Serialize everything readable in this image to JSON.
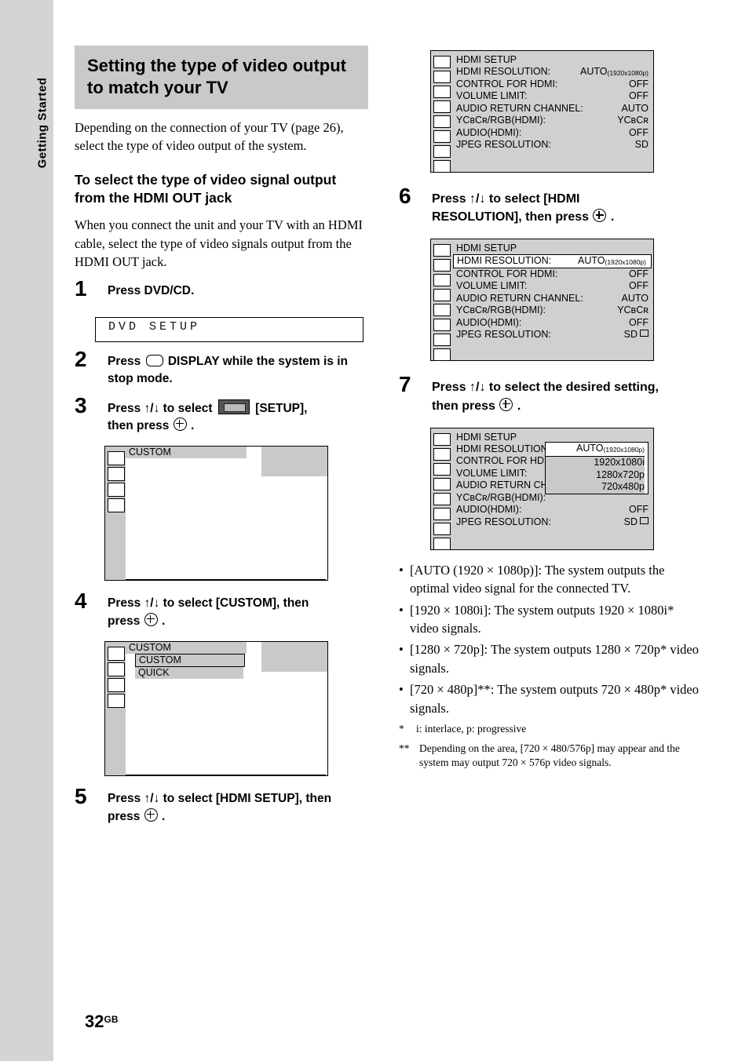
{
  "sidebar": {
    "label": "Getting Started"
  },
  "page": {
    "number": "32",
    "suffix": "GB"
  },
  "left": {
    "title": "Setting the type of video output to match your TV",
    "intro": "Depending on the connection of your TV (page 26), select the type of video output of the system.",
    "subhead": "To select the type of video signal output from the HDMI OUT jack",
    "para2": "When you connect the unit and your TV with an HDMI cable, select the type of video signals output from the HDMI OUT jack.",
    "steps": [
      {
        "num": "1",
        "text": "Press DVD/CD."
      },
      {
        "num": "2",
        "text_pre": "Press",
        "text_post": "DISPLAY while the system is in stop mode."
      },
      {
        "num": "3",
        "text_pre": "Press ↑/↓ to select",
        "text_mid": "[SETUP],",
        "text_post": "then press"
      },
      {
        "num": "4",
        "text_pre": "Press ↑/↓ to select [CUSTOM], then",
        "text_post": "press"
      },
      {
        "num": "5",
        "text_pre": "Press ↑/↓ to select [HDMI SETUP], then",
        "text_post": "press"
      }
    ],
    "fl_display": "DVD  SETUP",
    "osd1": {
      "row1": "CUSTOM"
    },
    "osd2": {
      "row1": "CUSTOM",
      "row2": "CUSTOM",
      "row3": "QUICK"
    }
  },
  "right": {
    "steps": [
      {
        "num": "6",
        "text_pre": "Press ↑/↓ to select [HDMI",
        "text_mid": "RESOLUTION], then press",
        "text_post": "."
      },
      {
        "num": "7",
        "text_pre": "Press ↑/↓ to select the desired setting,",
        "text_post": "then press"
      }
    ],
    "screen1": {
      "title": "HDMI SETUP",
      "rows": [
        {
          "label": "HDMI RESOLUTION:",
          "value": "AUTO",
          "value_sub": "(1920x1080p)"
        },
        {
          "label": "CONTROL FOR HDMI:",
          "value": "OFF"
        },
        {
          "label": "VOLUME LIMIT:",
          "value": "OFF"
        },
        {
          "label": "AUDIO RETURN CHANNEL:",
          "value": "AUTO"
        },
        {
          "label": "YCʙCʀ/RGB(HDMI):",
          "value": "YCʙCʀ"
        },
        {
          "label": "AUDIO(HDMI):",
          "value": "OFF"
        },
        {
          "label": "JPEG RESOLUTION:",
          "value": "SD"
        }
      ]
    },
    "screen2": {
      "title": "HDMI SETUP",
      "rows": [
        {
          "label": "HDMI RESOLUTION:",
          "value": "AUTO",
          "value_sub": "(1920x1080p)",
          "selected": true
        },
        {
          "label": "CONTROL FOR HDMI:",
          "value": "OFF"
        },
        {
          "label": "VOLUME LIMIT:",
          "value": "OFF"
        },
        {
          "label": "AUDIO RETURN CHANNEL:",
          "value": "AUTO"
        },
        {
          "label": "YCʙCʀ/RGB(HDMI):",
          "value": "YCʙCʀ"
        },
        {
          "label": "AUDIO(HDMI):",
          "value": "OFF"
        },
        {
          "label": "JPEG RESOLUTION:",
          "value": "SD"
        }
      ]
    },
    "screen3": {
      "title": "HDMI SETUP",
      "rows": [
        {
          "label": "HDMI RESOLUTION:",
          "value": "AUTO",
          "value_sub": "(1920x1080p)"
        },
        {
          "label": "CONTROL FOR HDM",
          "value": ""
        },
        {
          "label": "VOLUME LIMIT:",
          "value": ""
        },
        {
          "label": "AUDIO RETURN CH",
          "value": ""
        },
        {
          "label": "YCʙCʀ/RGB(HDMI):",
          "value": ""
        },
        {
          "label": "AUDIO(HDMI):",
          "value": "OFF"
        },
        {
          "label": "JPEG RESOLUTION:",
          "value": "SD"
        }
      ],
      "popup": [
        {
          "value": "AUTO",
          "value_sub": "(1920x1080p)",
          "selected": true
        },
        {
          "value": "1920x1080i"
        },
        {
          "value": "1280x720p"
        },
        {
          "value": "720x480p"
        }
      ]
    },
    "bullets": [
      "[AUTO (1920 × 1080p)]: The system outputs the optimal video signal for the connected TV.",
      "[1920 × 1080i]: The system outputs 1920 × 1080i* video signals.",
      "[1280 × 720p]: The system outputs 1280 × 720p* video signals.",
      "[720 × 480p]**: The system outputs 720 × 480p* video signals."
    ],
    "note1_mark": "*",
    "note1": "i: interlace, p: progressive",
    "note2_mark": "**",
    "note2": "Depending on the area, [720 × 480/576p] may appear and the system may output 720 × 576p video signals."
  }
}
